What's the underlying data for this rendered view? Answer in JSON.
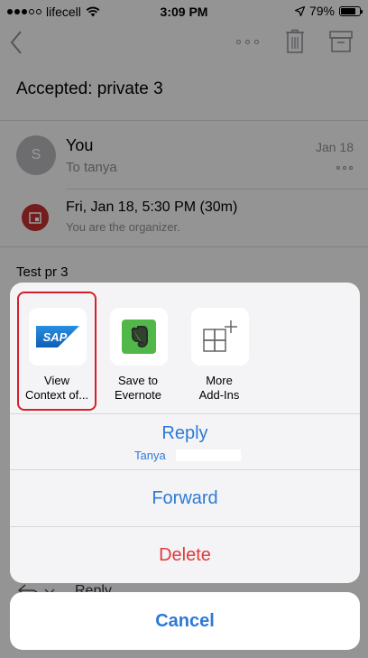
{
  "status_bar": {
    "carrier": "lifecell",
    "time": "3:09 PM",
    "battery": "79%",
    "battery_level": 0.79
  },
  "email": {
    "subject": "Accepted: private 3",
    "avatar_initial": "S",
    "sender": "You",
    "to": "To tanya",
    "date": "Jan 18",
    "event_time": "Fri, Jan 18, 5:30 PM (30m)",
    "event_note": "You are the organizer.",
    "body": "Test pr 3",
    "reply_label": "Reply"
  },
  "addins": [
    {
      "label": "View Context of...",
      "icon": "sap-logo",
      "logo_text": "SAP",
      "highlighted": true
    },
    {
      "label": "Save to Evernote",
      "icon": "evernote-icon"
    },
    {
      "label": "More Add-Ins",
      "icon": "add-ins-grid-icon"
    }
  ],
  "actions": {
    "reply": "Reply",
    "reply_recipient": "Tanya",
    "forward": "Forward",
    "delete": "Delete",
    "cancel": "Cancel"
  },
  "colors": {
    "accent": "#2d7ad6",
    "destructive": "#e03a3a",
    "highlight": "#d3202a",
    "calendar": "#c3302f",
    "evernote": "#51b748",
    "sap": "#1a73c8"
  }
}
